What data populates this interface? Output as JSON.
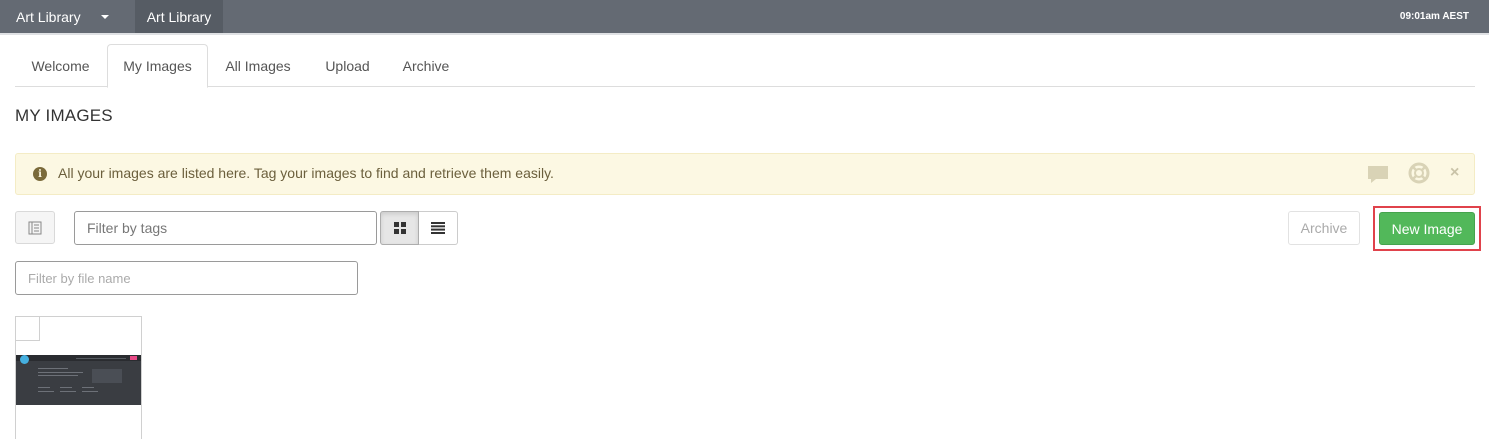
{
  "topbar": {
    "app_menu_label": "Art Library",
    "breadcrumb": "Art Library",
    "time": "09:01am AEST"
  },
  "tabs": [
    {
      "label": "Welcome",
      "active": false
    },
    {
      "label": "My Images",
      "active": true
    },
    {
      "label": "All Images",
      "active": false
    },
    {
      "label": "Upload",
      "active": false
    },
    {
      "label": "Archive",
      "active": false
    }
  ],
  "page_title": "MY IMAGES",
  "alert": {
    "text": "All your images are listed here. Tag your images to find and retrieve them easily.",
    "icons": [
      "info-icon",
      "chat-icon",
      "help-icon",
      "close-icon"
    ],
    "close_glyph": "×"
  },
  "toolbar": {
    "tag_filter_placeholder": "Filter by tags",
    "view_mode": "grid",
    "archive_label": "Archive",
    "new_image_label": "New Image"
  },
  "name_filter_placeholder": "Filter by file name",
  "images": [
    {
      "selected": false
    }
  ],
  "colors": {
    "topbar": "#646a73",
    "alert_bg": "#fcf8e3",
    "new_button": "#52b85a",
    "highlight": "#e0424b"
  }
}
